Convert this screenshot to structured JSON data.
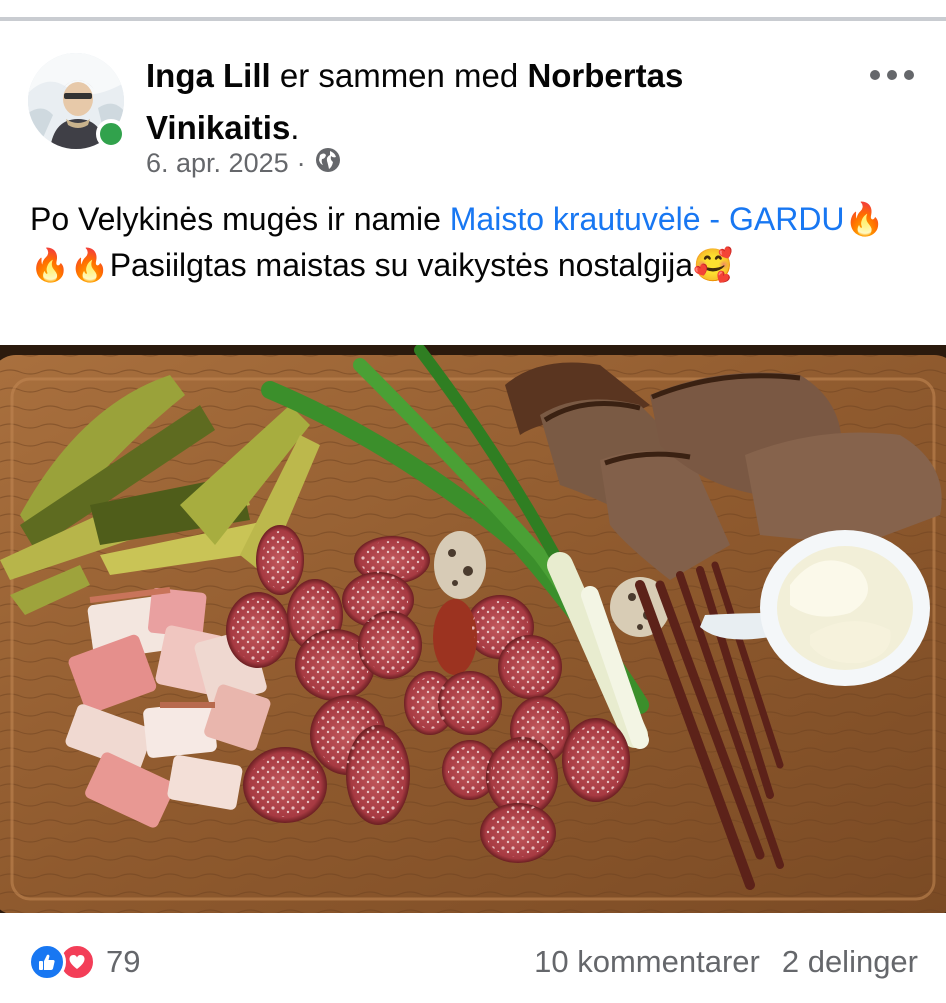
{
  "post": {
    "author": "Inga Lill",
    "with_text": "er sammen med",
    "tagged": "Norbertas Vinikaitis",
    "period": ".",
    "date": "6. apr. 2025",
    "separator": "·",
    "privacy_icon": "globe-icon",
    "text_before_link": "Po Velykinės mugės ir namie ",
    "link_text": "Maisto krautuvėlė - GARDU",
    "emoji_fire": "🔥",
    "text_after_link": "Pasiilgtas maistas su vaikystės nostalgija",
    "emoji_love": "🥰"
  },
  "engagement": {
    "reaction_icons": [
      "like-icon",
      "love-icon"
    ],
    "reaction_count": "79",
    "comments": "10 kommentarer",
    "shares": "2 delinger"
  },
  "colors": {
    "link": "#1877f2",
    "secondary_text": "#65676b",
    "online": "#31a24c",
    "like": "#1877f2",
    "love": "#f33e58"
  }
}
